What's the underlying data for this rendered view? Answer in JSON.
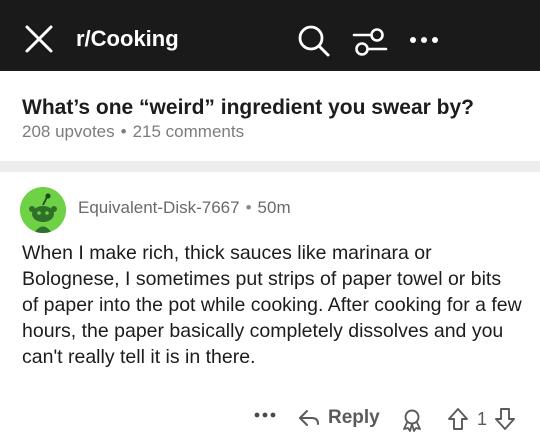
{
  "header": {
    "subreddit": "r/Cooking",
    "icons": [
      "close-icon",
      "search-icon",
      "filter-icon",
      "more-icon"
    ]
  },
  "post": {
    "title": "What’s one “weird” ingredient you swear by?",
    "upvotes": "208 upvotes",
    "separator": "•",
    "comments": "215 comments"
  },
  "comment": {
    "author": "Equivalent-Disk-7667",
    "separator": "•",
    "time": "50m",
    "body": "When I make rich, thick sauces like marinara or Bolognese, I sometimes put strips of paper towel or bits of paper into the pot while cooking. After cooking for a few hours, the paper basically completely dissolves and you can't really tell it is in there.",
    "actions": {
      "more": "•••",
      "reply_label": "Reply",
      "vote_count": "1"
    }
  },
  "colors": {
    "topbar_bg": "#1a1a1b",
    "avatar_bg": "#6fd146",
    "meta_text": "#7c7c7c"
  }
}
